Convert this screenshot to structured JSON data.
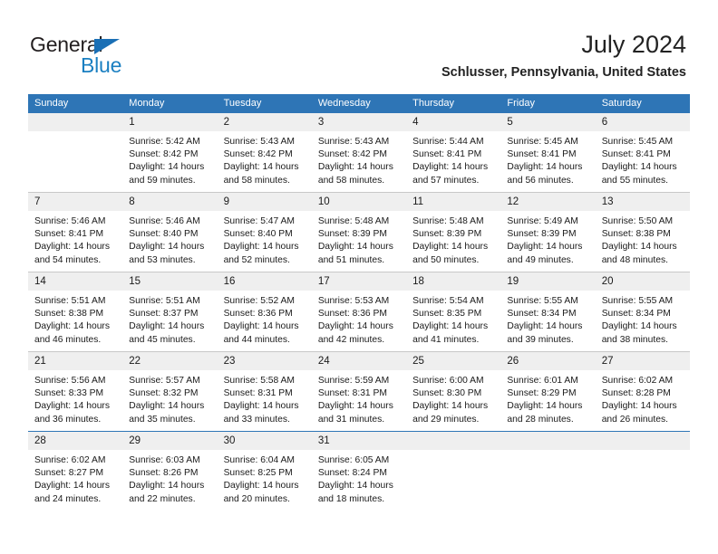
{
  "brand": {
    "line1": "General",
    "line2": "Blue",
    "triangle_color": "#1a6fb5",
    "line2_color": "#1a7fc1"
  },
  "header": {
    "title": "July 2024",
    "subtitle": "Schlusser, Pennsylvania, United States"
  },
  "theme": {
    "header_blue": "#2e75b6",
    "daynum_band": "#efefef",
    "separator": "#c8c8c8",
    "text": "#1a1a1a"
  },
  "weekdays": [
    "Sunday",
    "Monday",
    "Tuesday",
    "Wednesday",
    "Thursday",
    "Friday",
    "Saturday"
  ],
  "weeks": [
    {
      "daynums": [
        "",
        "1",
        "2",
        "3",
        "4",
        "5",
        "6"
      ],
      "cells": [
        {
          "sunrise": "",
          "sunset": "",
          "daylight1": "",
          "daylight2": ""
        },
        {
          "sunrise": "Sunrise: 5:42 AM",
          "sunset": "Sunset: 8:42 PM",
          "daylight1": "Daylight: 14 hours",
          "daylight2": "and 59 minutes."
        },
        {
          "sunrise": "Sunrise: 5:43 AM",
          "sunset": "Sunset: 8:42 PM",
          "daylight1": "Daylight: 14 hours",
          "daylight2": "and 58 minutes."
        },
        {
          "sunrise": "Sunrise: 5:43 AM",
          "sunset": "Sunset: 8:42 PM",
          "daylight1": "Daylight: 14 hours",
          "daylight2": "and 58 minutes."
        },
        {
          "sunrise": "Sunrise: 5:44 AM",
          "sunset": "Sunset: 8:41 PM",
          "daylight1": "Daylight: 14 hours",
          "daylight2": "and 57 minutes."
        },
        {
          "sunrise": "Sunrise: 5:45 AM",
          "sunset": "Sunset: 8:41 PM",
          "daylight1": "Daylight: 14 hours",
          "daylight2": "and 56 minutes."
        },
        {
          "sunrise": "Sunrise: 5:45 AM",
          "sunset": "Sunset: 8:41 PM",
          "daylight1": "Daylight: 14 hours",
          "daylight2": "and 55 minutes."
        }
      ]
    },
    {
      "daynums": [
        "7",
        "8",
        "9",
        "10",
        "11",
        "12",
        "13"
      ],
      "cells": [
        {
          "sunrise": "Sunrise: 5:46 AM",
          "sunset": "Sunset: 8:41 PM",
          "daylight1": "Daylight: 14 hours",
          "daylight2": "and 54 minutes."
        },
        {
          "sunrise": "Sunrise: 5:46 AM",
          "sunset": "Sunset: 8:40 PM",
          "daylight1": "Daylight: 14 hours",
          "daylight2": "and 53 minutes."
        },
        {
          "sunrise": "Sunrise: 5:47 AM",
          "sunset": "Sunset: 8:40 PM",
          "daylight1": "Daylight: 14 hours",
          "daylight2": "and 52 minutes."
        },
        {
          "sunrise": "Sunrise: 5:48 AM",
          "sunset": "Sunset: 8:39 PM",
          "daylight1": "Daylight: 14 hours",
          "daylight2": "and 51 minutes."
        },
        {
          "sunrise": "Sunrise: 5:48 AM",
          "sunset": "Sunset: 8:39 PM",
          "daylight1": "Daylight: 14 hours",
          "daylight2": "and 50 minutes."
        },
        {
          "sunrise": "Sunrise: 5:49 AM",
          "sunset": "Sunset: 8:39 PM",
          "daylight1": "Daylight: 14 hours",
          "daylight2": "and 49 minutes."
        },
        {
          "sunrise": "Sunrise: 5:50 AM",
          "sunset": "Sunset: 8:38 PM",
          "daylight1": "Daylight: 14 hours",
          "daylight2": "and 48 minutes."
        }
      ]
    },
    {
      "daynums": [
        "14",
        "15",
        "16",
        "17",
        "18",
        "19",
        "20"
      ],
      "cells": [
        {
          "sunrise": "Sunrise: 5:51 AM",
          "sunset": "Sunset: 8:38 PM",
          "daylight1": "Daylight: 14 hours",
          "daylight2": "and 46 minutes."
        },
        {
          "sunrise": "Sunrise: 5:51 AM",
          "sunset": "Sunset: 8:37 PM",
          "daylight1": "Daylight: 14 hours",
          "daylight2": "and 45 minutes."
        },
        {
          "sunrise": "Sunrise: 5:52 AM",
          "sunset": "Sunset: 8:36 PM",
          "daylight1": "Daylight: 14 hours",
          "daylight2": "and 44 minutes."
        },
        {
          "sunrise": "Sunrise: 5:53 AM",
          "sunset": "Sunset: 8:36 PM",
          "daylight1": "Daylight: 14 hours",
          "daylight2": "and 42 minutes."
        },
        {
          "sunrise": "Sunrise: 5:54 AM",
          "sunset": "Sunset: 8:35 PM",
          "daylight1": "Daylight: 14 hours",
          "daylight2": "and 41 minutes."
        },
        {
          "sunrise": "Sunrise: 5:55 AM",
          "sunset": "Sunset: 8:34 PM",
          "daylight1": "Daylight: 14 hours",
          "daylight2": "and 39 minutes."
        },
        {
          "sunrise": "Sunrise: 5:55 AM",
          "sunset": "Sunset: 8:34 PM",
          "daylight1": "Daylight: 14 hours",
          "daylight2": "and 38 minutes."
        }
      ]
    },
    {
      "daynums": [
        "21",
        "22",
        "23",
        "24",
        "25",
        "26",
        "27"
      ],
      "cells": [
        {
          "sunrise": "Sunrise: 5:56 AM",
          "sunset": "Sunset: 8:33 PM",
          "daylight1": "Daylight: 14 hours",
          "daylight2": "and 36 minutes."
        },
        {
          "sunrise": "Sunrise: 5:57 AM",
          "sunset": "Sunset: 8:32 PM",
          "daylight1": "Daylight: 14 hours",
          "daylight2": "and 35 minutes."
        },
        {
          "sunrise": "Sunrise: 5:58 AM",
          "sunset": "Sunset: 8:31 PM",
          "daylight1": "Daylight: 14 hours",
          "daylight2": "and 33 minutes."
        },
        {
          "sunrise": "Sunrise: 5:59 AM",
          "sunset": "Sunset: 8:31 PM",
          "daylight1": "Daylight: 14 hours",
          "daylight2": "and 31 minutes."
        },
        {
          "sunrise": "Sunrise: 6:00 AM",
          "sunset": "Sunset: 8:30 PM",
          "daylight1": "Daylight: 14 hours",
          "daylight2": "and 29 minutes."
        },
        {
          "sunrise": "Sunrise: 6:01 AM",
          "sunset": "Sunset: 8:29 PM",
          "daylight1": "Daylight: 14 hours",
          "daylight2": "and 28 minutes."
        },
        {
          "sunrise": "Sunrise: 6:02 AM",
          "sunset": "Sunset: 8:28 PM",
          "daylight1": "Daylight: 14 hours",
          "daylight2": "and 26 minutes."
        }
      ]
    },
    {
      "daynums": [
        "28",
        "29",
        "30",
        "31",
        "",
        "",
        ""
      ],
      "cells": [
        {
          "sunrise": "Sunrise: 6:02 AM",
          "sunset": "Sunset: 8:27 PM",
          "daylight1": "Daylight: 14 hours",
          "daylight2": "and 24 minutes."
        },
        {
          "sunrise": "Sunrise: 6:03 AM",
          "sunset": "Sunset: 8:26 PM",
          "daylight1": "Daylight: 14 hours",
          "daylight2": "and 22 minutes."
        },
        {
          "sunrise": "Sunrise: 6:04 AM",
          "sunset": "Sunset: 8:25 PM",
          "daylight1": "Daylight: 14 hours",
          "daylight2": "and 20 minutes."
        },
        {
          "sunrise": "Sunrise: 6:05 AM",
          "sunset": "Sunset: 8:24 PM",
          "daylight1": "Daylight: 14 hours",
          "daylight2": "and 18 minutes."
        },
        {
          "sunrise": "",
          "sunset": "",
          "daylight1": "",
          "daylight2": ""
        },
        {
          "sunrise": "",
          "sunset": "",
          "daylight1": "",
          "daylight2": ""
        },
        {
          "sunrise": "",
          "sunset": "",
          "daylight1": "",
          "daylight2": ""
        }
      ]
    }
  ]
}
